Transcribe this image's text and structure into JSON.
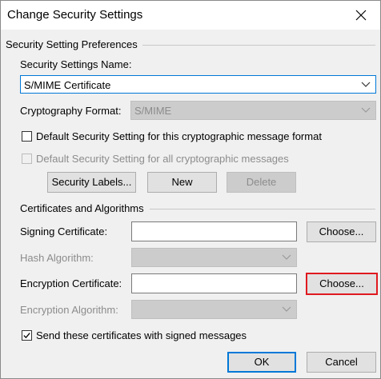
{
  "window": {
    "title": "Change Security Settings"
  },
  "preferences": {
    "group_label": "Security Setting Preferences",
    "name_label": "Security Settings Name:",
    "name_value": "S/MIME Certificate",
    "crypto_label": "Cryptography Format:",
    "crypto_value": "S/MIME",
    "default_format_label": "Default Security Setting for this cryptographic message format",
    "default_format_checked": false,
    "default_all_label": "Default Security Setting for all cryptographic messages",
    "default_all_checked": false,
    "labels_button": "Security Labels...",
    "new_button": "New",
    "delete_button": "Delete"
  },
  "certificates": {
    "group_label": "Certificates and Algorithms",
    "signing_label": "Signing Certificate:",
    "signing_value": "",
    "signing_choose": "Choose...",
    "hash_label": "Hash Algorithm:",
    "encryption_label": "Encryption Certificate:",
    "encryption_value": "",
    "encryption_choose": "Choose...",
    "enc_alg_label": "Encryption Algorithm:",
    "send_label": "Send these certificates with signed messages",
    "send_checked": true
  },
  "footer": {
    "ok": "OK",
    "cancel": "Cancel"
  },
  "colors": {
    "accent": "#0078d7",
    "highlight": "#e0191f"
  }
}
